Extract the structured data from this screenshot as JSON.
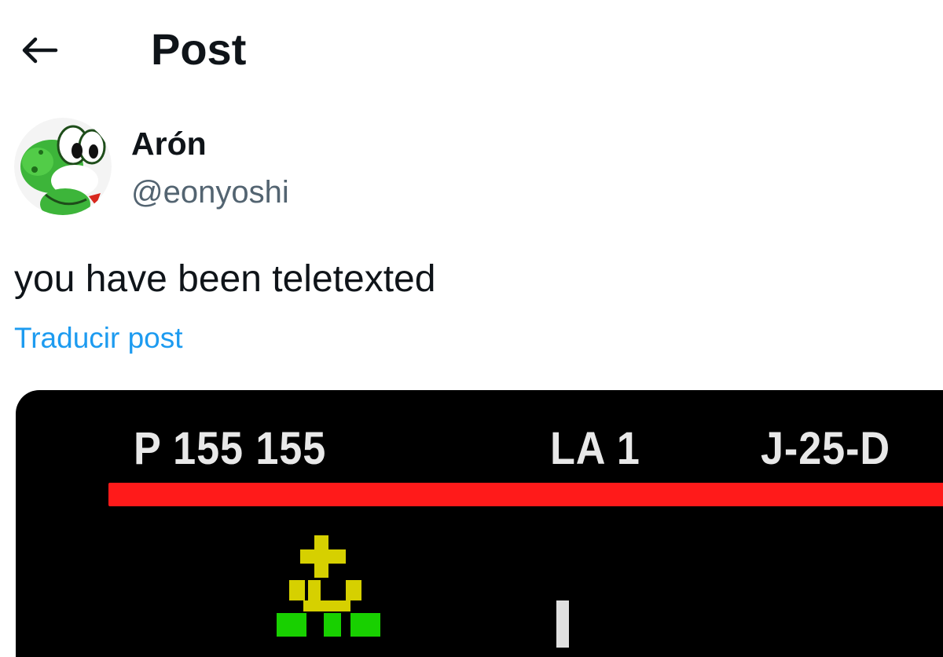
{
  "header": {
    "title": "Post",
    "back_icon": "back-arrow-icon"
  },
  "author": {
    "name": "Arón",
    "handle": "@eonyoshi",
    "avatar": "yoshi-avatar"
  },
  "post": {
    "text": "you have been teletexted",
    "translate_label": "Traducir post"
  },
  "media": {
    "header_left": "P 155 155",
    "header_mid": "LA 1",
    "header_right": "J-25-D",
    "colors": {
      "bar": "#ff1a1a",
      "text": "#e8e8e8",
      "yellow": "#d6d000",
      "green": "#18d000"
    }
  }
}
